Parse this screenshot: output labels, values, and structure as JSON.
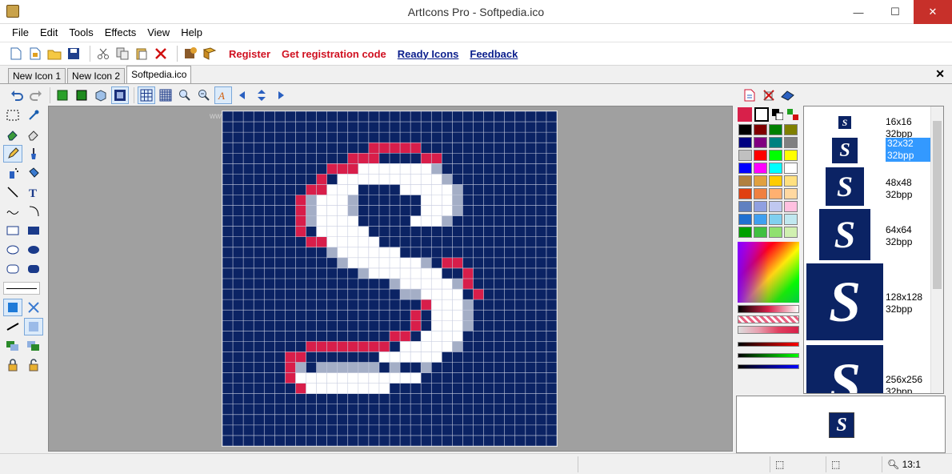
{
  "window": {
    "title": "ArtIcons Pro - Softpedia.ico",
    "minimize": "—",
    "maximize": "☐",
    "close": "✕"
  },
  "menu": [
    "File",
    "Edit",
    "Tools",
    "Effects",
    "View",
    "Help"
  ],
  "toolbar": {
    "links": [
      {
        "label": "Register",
        "style": "red"
      },
      {
        "label": "Get registration code",
        "style": "red"
      },
      {
        "label": "Ready Icons",
        "style": "blue"
      },
      {
        "label": "Feedback",
        "style": "blue"
      }
    ]
  },
  "tabs": [
    {
      "label": "New Icon 1",
      "active": false
    },
    {
      "label": "New Icon 2",
      "active": false
    },
    {
      "label": "Softpedia.ico",
      "active": true
    }
  ],
  "tab_close": "✕",
  "canvas": {
    "watermark": "www.softpedia.com",
    "grid_size": 32,
    "background": "#0b2364"
  },
  "icon_sizes": [
    {
      "size": "16x16",
      "depth": "32bpp",
      "selected": false
    },
    {
      "size": "32x32",
      "depth": "32bpp",
      "selected": true
    },
    {
      "size": "48x48",
      "depth": "32bpp",
      "selected": false
    },
    {
      "size": "64x64",
      "depth": "32bpp",
      "selected": false
    },
    {
      "size": "128x128",
      "depth": "32bpp",
      "selected": false
    },
    {
      "size": "256x256",
      "depth": "32bpp",
      "selected": false
    }
  ],
  "icon_glyph": "S",
  "palette": [
    "#000000",
    "#800000",
    "#008000",
    "#808000",
    "#000080",
    "#800080",
    "#008080",
    "#808080",
    "#c0c0c0",
    "#ff0000",
    "#00ff00",
    "#ffff00",
    "#0000ff",
    "#ff00ff",
    "#00ffff",
    "#ffffff",
    "#b08040",
    "#e0a040",
    "#ffcc00",
    "#ffe080",
    "#e04010",
    "#f08040",
    "#ffb070",
    "#ffd8a0",
    "#6080c0",
    "#90a0e0",
    "#c0c8f0",
    "#ffc0e0",
    "#2070d0",
    "#40a0f0",
    "#80d0f0",
    "#c0e8f0",
    "#00a000",
    "#40c040",
    "#90e070",
    "#d0f0b0"
  ],
  "status": {
    "zoom": "13:1"
  },
  "colors": {
    "accent_red": "#d01020",
    "link_blue": "#0a1e8c",
    "icon_bg": "#0b2364",
    "stroke_red": "#d81e4a"
  }
}
